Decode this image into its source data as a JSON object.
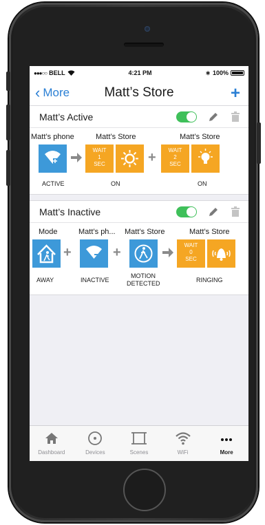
{
  "status": {
    "carrier": "BELL",
    "time": "4:21 PM",
    "battery": "100%"
  },
  "nav": {
    "back_label": "More",
    "title": "Matt’s Store",
    "add_label": "+"
  },
  "rules": [
    {
      "name": "Matt’s Active",
      "enabled": true,
      "devices": [
        "Matt’s phone",
        "Matt’s  Store",
        "Matt’s Store"
      ],
      "waits": [
        {
          "line1": "WAIT",
          "line2": "1",
          "line3": "SEC"
        },
        {
          "line1": "WAIT",
          "line2": "2",
          "line3": "SEC"
        }
      ],
      "labels": [
        "ACTIVE",
        "ON",
        "ON"
      ],
      "operators": [
        "+"
      ]
    },
    {
      "name": "Matt’s Inactive",
      "enabled": true,
      "devices": [
        "Mode",
        "Matt’s ph...",
        "Matt’s Store",
        "Matt’s Store"
      ],
      "waits": [
        {
          "line1": "WAIT",
          "line2": "0",
          "line3": "SEC"
        }
      ],
      "labels": [
        "AWAY",
        "INACTIVE",
        "MOTION",
        "DETECTED",
        "RINGING"
      ],
      "operators": [
        "+",
        "+"
      ]
    }
  ],
  "tabs": [
    {
      "label": "Dashboard",
      "icon": "home-icon",
      "active": false
    },
    {
      "label": "Devices",
      "icon": "devices-icon",
      "active": false
    },
    {
      "label": "Scenes",
      "icon": "scenes-icon",
      "active": false
    },
    {
      "label": "WiFi",
      "icon": "wifi-icon",
      "active": false
    },
    {
      "label": "More",
      "icon": "more-icon",
      "active": true
    }
  ],
  "colors": {
    "accent": "#2a7fd4",
    "tile_blue": "#3d99d9",
    "tile_orange": "#f5a623",
    "toggle_on": "#3fc05a"
  }
}
